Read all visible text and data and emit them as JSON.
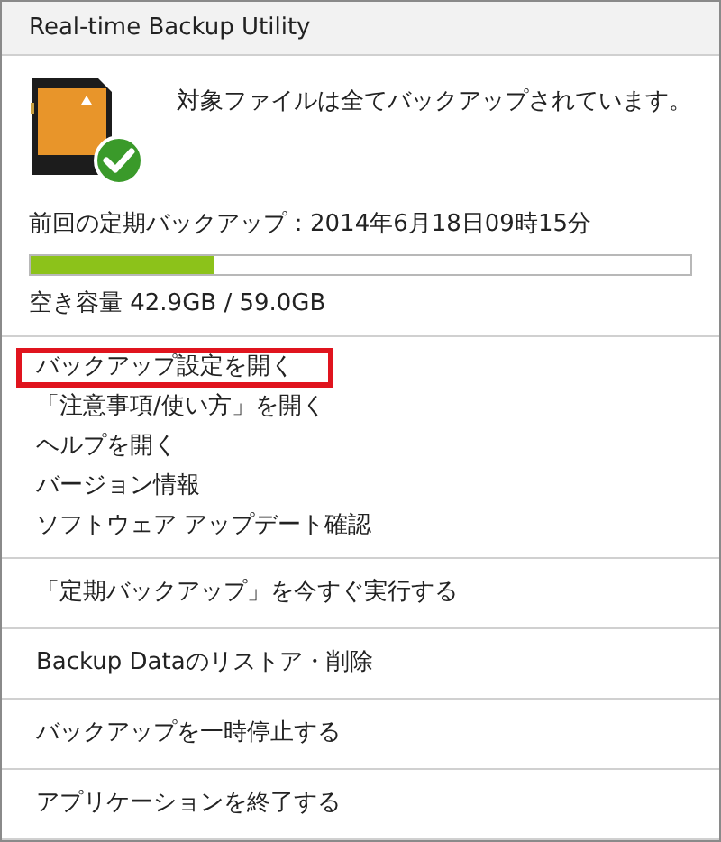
{
  "window": {
    "title": "Real-time Backup Utility"
  },
  "status": {
    "message": "対象ファイルは全てバックアップされています。",
    "last_backup": "前回の定期バックアップ：2014年6月18日09時15分",
    "usage": {
      "level": 0.28
    },
    "free_space": "空き容量 42.9GB / 59.0GB"
  },
  "menu_groups": [
    {
      "items": [
        {
          "label": "バックアップ設定を開く",
          "highlighted": true
        },
        {
          "label": "「注意事項/使い方」を開く",
          "highlighted": false
        },
        {
          "label": "ヘルプを開く",
          "highlighted": false
        },
        {
          "label": "バージョン情報",
          "highlighted": false
        },
        {
          "label": "ソフトウェア アップデート確認",
          "highlighted": false
        }
      ]
    },
    {
      "items": [
        {
          "label": "「定期バックアップ」を今すぐ実行する",
          "highlighted": false
        }
      ]
    },
    {
      "items": [
        {
          "label": "Backup Dataのリストア・削除",
          "highlighted": false
        }
      ]
    },
    {
      "items": [
        {
          "label": "バックアップを一時停止する",
          "highlighted": false
        }
      ]
    },
    {
      "items": [
        {
          "label": "アプリケーションを終了する",
          "highlighted": false
        }
      ]
    }
  ]
}
